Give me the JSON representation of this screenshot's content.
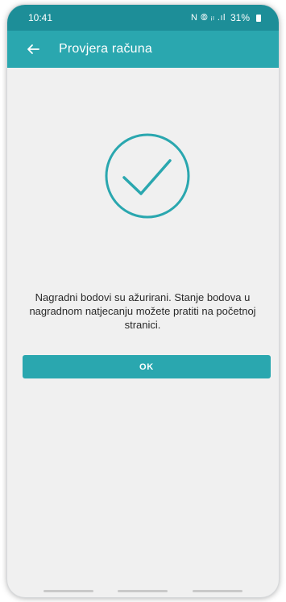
{
  "status_bar": {
    "time": "10:41",
    "icons": "N ⦾ ᵢₗ .ıl",
    "battery": "31%"
  },
  "app_bar": {
    "title": "Provjera računa",
    "back_icon": "back-arrow-icon"
  },
  "main": {
    "success_icon": "check-circle-icon",
    "message": "Nagradni bodovi su ažurirani. Stanje bodova u nagradnom natjecanju možete pratiti na početnoj stranici.",
    "ok_label": "OK"
  },
  "colors": {
    "status_bar": "#1d8e98",
    "accent": "#2aa7af",
    "background": "#f0f0f0"
  }
}
